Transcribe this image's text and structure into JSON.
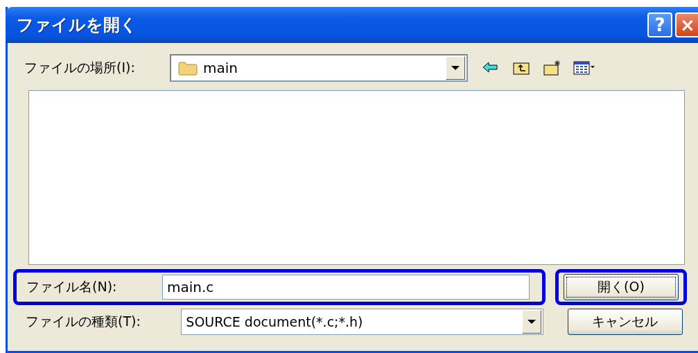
{
  "window": {
    "title": "ファイルを開く",
    "title_buttons": [
      {
        "kind": "help",
        "label": "?"
      },
      {
        "kind": "close",
        "label": "×"
      }
    ]
  },
  "location": {
    "label": "ファイルの場所(I):",
    "value": "main"
  },
  "toolbar": [
    {
      "kind": "back"
    },
    {
      "kind": "up"
    },
    {
      "kind": "newfolder"
    },
    {
      "kind": "view"
    }
  ],
  "file_name": {
    "label": "ファイル名(N):",
    "value": "main.c",
    "highlighted": true
  },
  "file_type": {
    "label": "ファイルの種類(T):",
    "value": "SOURCE document(*.c;*.h)"
  },
  "buttons": [
    {
      "label": "開く(O)",
      "default": true,
      "highlighted": true
    },
    {
      "label": "キャンセル",
      "default": false,
      "highlighted": false
    }
  ]
}
